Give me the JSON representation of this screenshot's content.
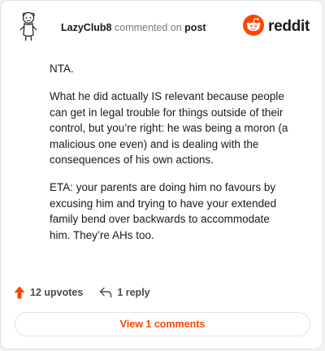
{
  "header": {
    "username": "LazyClub8",
    "action_text": "commented on",
    "post_link": "post",
    "logo_text": "reddit"
  },
  "comment": {
    "paragraphs": [
      "NTA.",
      "What he did actually IS relevant because people can get in legal trouble for things outside of their control, but you’re right: he was being a moron (a malicious one even) and is dealing with the consequences of his own actions.",
      "ETA: your parents are doing him no favours by excusing him and trying to have your extended family bend over backwards to accommodate him. They’re AHs too."
    ]
  },
  "actions": {
    "upvotes": "12 upvotes",
    "replies": "1 reply"
  },
  "view_comments_label": "View 1 comments",
  "colors": {
    "accent": "#ff4500",
    "text": "#1a1a1b",
    "muted": "#7a7a7a"
  },
  "icons": [
    "avatar-icon",
    "reddit-logo-icon",
    "upvote-arrow-icon",
    "reply-arrow-icon"
  ]
}
